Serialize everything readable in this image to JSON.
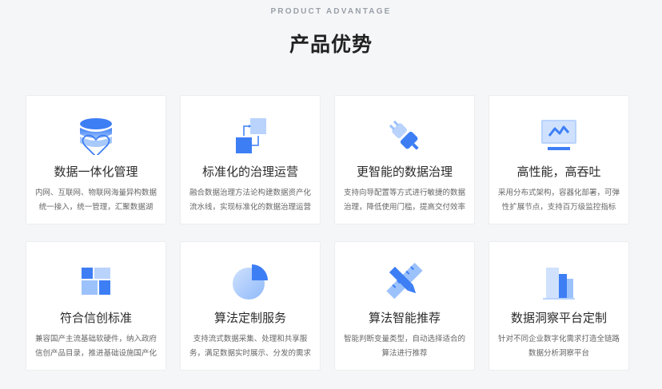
{
  "header": {
    "eyebrow": "PRODUCT ADVANTAGE",
    "title": "产品优势"
  },
  "accent_colors": {
    "primary": "#3d7ef5",
    "light": "#bcd6fd"
  },
  "cards": [
    {
      "icon": "database-heart-icon",
      "title": "数据一体化管理",
      "desc": "内网、互联网、物联网海量异构数据统一接入，统一管理，汇聚数据湖"
    },
    {
      "icon": "flow-blocks-icon",
      "title": "标准化的治理运营",
      "desc": "融合数据治理方法论构建数据资产化流水线，实现标准化的数据治理运营"
    },
    {
      "icon": "plug-icon",
      "title": "更智能的数据治理",
      "desc": "支持向导配置等方式进行敏捷的数据治理，降低使用门槛，提高交付效率"
    },
    {
      "icon": "monitor-chart-icon",
      "title": "高性能，高吞吐",
      "desc": "采用分布式架构，容器化部署，可弹性扩展节点，支持百万级监控指标"
    },
    {
      "icon": "grid-blocks-icon",
      "title": "符合信创标准",
      "desc": "兼容国产主流基础软硬件，纳入政府信创产品目录，推进基础设施国产化"
    },
    {
      "icon": "pie-chart-icon",
      "title": "算法定制服务",
      "desc": "支持流式数据采集、处理和共享服务，满足数据实时展示、分发的需求"
    },
    {
      "icon": "ruler-pencil-icon",
      "title": "算法智能推荐",
      "desc": "智能判断变量类型，自动选择适合的算法进行推荐"
    },
    {
      "icon": "buildings-icon",
      "title": "数据洞察平台定制",
      "desc": "针对不同企业数字化需求打造全链路数据分析洞察平台"
    }
  ]
}
